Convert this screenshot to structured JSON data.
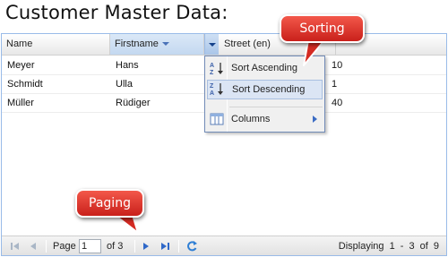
{
  "page": {
    "title": "Customer Master Data:"
  },
  "grid": {
    "columns": [
      "Name",
      "Firstname",
      "Street (en)"
    ],
    "rows": [
      {
        "name": "Meyer",
        "firstname": "Hans",
        "street": "10"
      },
      {
        "name": "Schmidt",
        "firstname": "Ulla",
        "street": "1"
      },
      {
        "name": "Müller",
        "firstname": "Rüdiger",
        "street": "40"
      }
    ]
  },
  "menu": {
    "items": [
      {
        "label": "Sort Ascending",
        "icon": "sort-ascending-icon"
      },
      {
        "label": "Sort Descending",
        "icon": "sort-descending-icon"
      },
      {
        "label": "Columns",
        "icon": "columns-icon"
      }
    ]
  },
  "paging": {
    "page_label": "Page",
    "page_value": "1",
    "of_label": "of 3",
    "display_text": "Displaying 1 - 3 of  9"
  },
  "callouts": {
    "sorting": "Sorting",
    "paging": "Paging"
  },
  "colors": {
    "callout": "#e23a2e",
    "header_border": "#99bbe8",
    "menu_hover": "#dbe5f4",
    "accent_blue": "#3b6cc4"
  }
}
